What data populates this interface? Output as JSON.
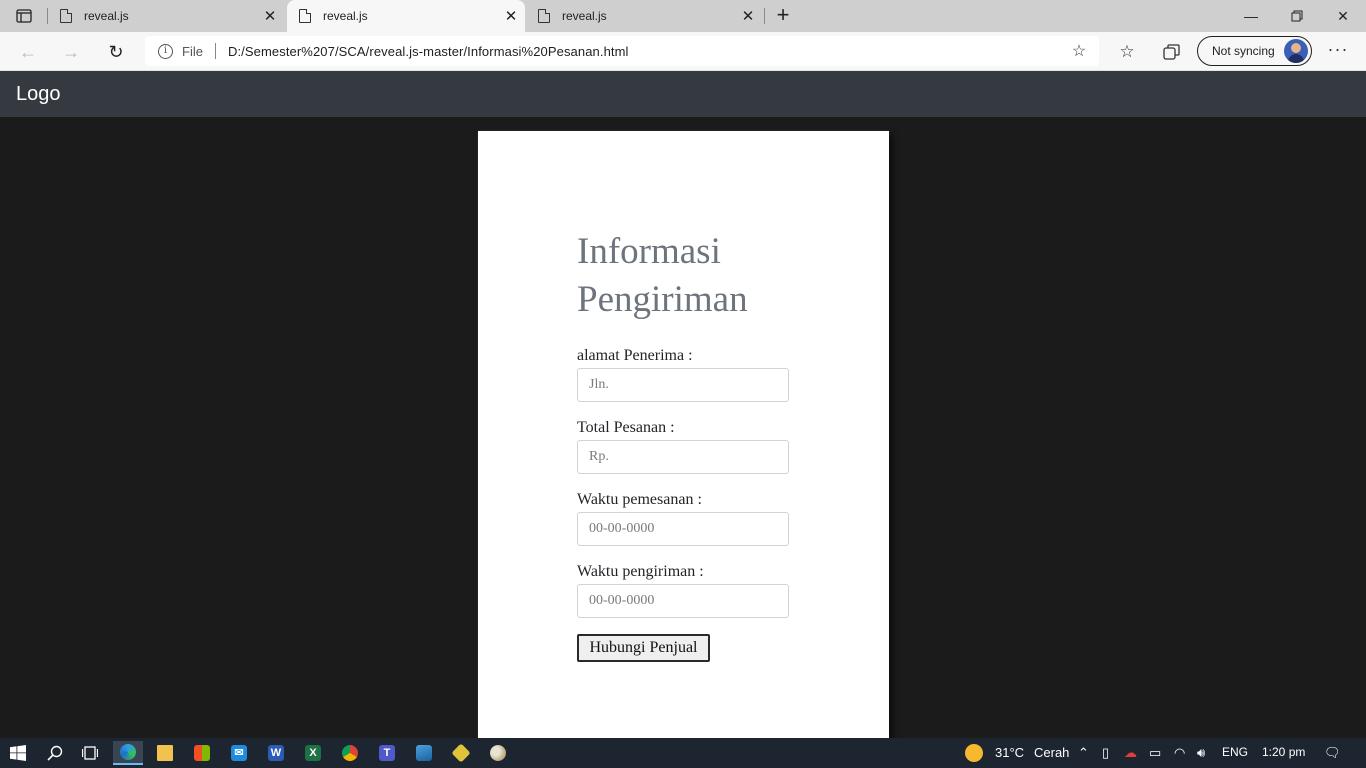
{
  "browser": {
    "tabs": [
      {
        "title": "reveal.js",
        "active": false
      },
      {
        "title": "reveal.js",
        "active": true
      },
      {
        "title": "reveal.js",
        "active": false
      }
    ],
    "address": {
      "scheme_label": "File",
      "url": "D:/Semester%207/SCA/reveal.js-master/Informasi%20Pesanan.html"
    },
    "profile": {
      "sync_label": "Not syncing"
    }
  },
  "page": {
    "header": {
      "logo_text": "Logo"
    },
    "form": {
      "title": "Informasi Pengiriman",
      "fields": [
        {
          "label": "alamat Penerima :",
          "placeholder": "Jln."
        },
        {
          "label": "Total Pesanan :",
          "placeholder": "Rp."
        },
        {
          "label": "Waktu pemesanan :",
          "placeholder": "00-00-0000"
        },
        {
          "label": "Waktu pengiriman :",
          "placeholder": "00-00-0000"
        }
      ],
      "submit_label": "Hubungi Penjual"
    }
  },
  "taskbar": {
    "weather": {
      "temperature": "31°C",
      "condition": "Cerah"
    },
    "language": "ENG",
    "time": "1:20 pm",
    "apps": [
      "start-icon",
      "search-icon",
      "task-view-icon",
      "edge-icon",
      "file-explorer-icon",
      "store-icon",
      "mail-icon",
      "word-icon",
      "excel-icon",
      "chrome-icon",
      "teams-icon",
      "photos-icon",
      "git-icon",
      "paint-icon"
    ]
  },
  "colors": {
    "page_background": "#1b1b1b",
    "header_background": "#343a40",
    "heading_color": "#6c757d",
    "taskbar_background": "#1c2530"
  }
}
